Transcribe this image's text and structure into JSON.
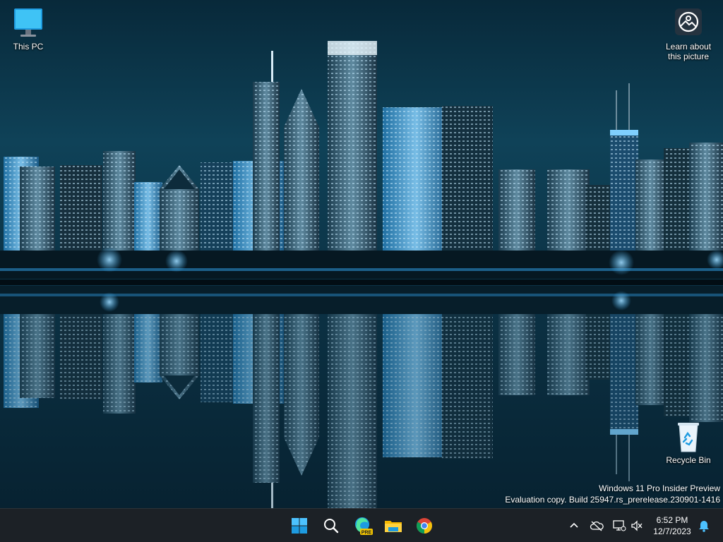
{
  "desktop": {
    "icons": [
      {
        "label": "This PC"
      },
      {
        "label": "Learn about this picture"
      },
      {
        "label": "Recycle Bin"
      }
    ]
  },
  "watermark": {
    "line1": "Windows 11 Pro Insider Preview",
    "line2": "Evaluation copy. Build 25947.rs_prerelease.230901-1416"
  },
  "taskbar": {
    "apps": [
      {
        "icon": "windows-start-icon"
      },
      {
        "icon": "search-icon"
      },
      {
        "icon": "edge-beta-icon",
        "badge": "PRE"
      },
      {
        "icon": "file-explorer-icon"
      },
      {
        "icon": "chrome-icon"
      }
    ],
    "tray": {
      "icons": [
        "chevron-up-icon",
        "onedrive-icon",
        "network-icon",
        "volume-muted-icon",
        "notification-bell-icon"
      ],
      "time": "6:52 PM",
      "date": "12/7/2023"
    }
  },
  "colors": {
    "taskbar": "#1c2126",
    "accent": "#0078d4",
    "wallpaper_sky": "#0d3a4f",
    "city_glow": "#3fa9e8"
  }
}
